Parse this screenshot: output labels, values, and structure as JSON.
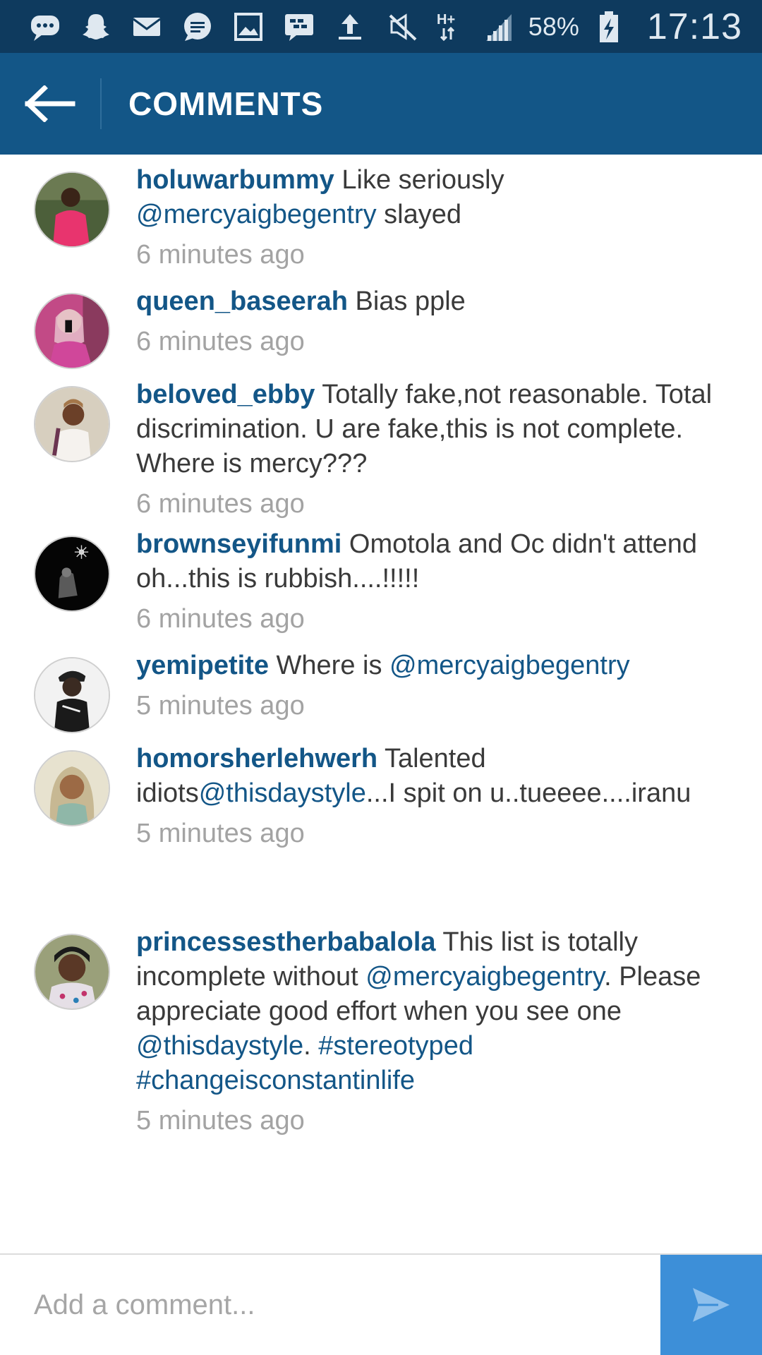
{
  "status_bar": {
    "battery_percent": "58%",
    "clock": "17:13",
    "network_label": "H+",
    "icons": [
      "messenger-icon",
      "snapchat-icon",
      "mail-icon",
      "chat-bubble-icon",
      "gallery-icon",
      "bbm-icon",
      "upload-icon",
      "mute-icon",
      "network-data-icon",
      "signal-icon",
      "battery-charging-icon"
    ]
  },
  "header": {
    "title": "COMMENTS",
    "back_icon": "back-arrow-icon"
  },
  "comments": [
    {
      "username": "holuwarbummy",
      "parts": [
        {
          "type": "text",
          "value": " Like seriously "
        },
        {
          "type": "mention",
          "value": "@mercyaigbegentry"
        },
        {
          "type": "text",
          "value": "  slayed"
        }
      ],
      "time": "6 minutes ago"
    },
    {
      "username": "queen_baseerah",
      "parts": [
        {
          "type": "text",
          "value": " Bias pple"
        }
      ],
      "time": "6 minutes ago"
    },
    {
      "username": "beloved_ebby",
      "parts": [
        {
          "type": "text",
          "value": " Totally fake,not reasonable. Total discrimination. U are fake,this is not complete. Where is mercy???"
        }
      ],
      "time": "6 minutes ago"
    },
    {
      "username": "brownseyifunmi",
      "parts": [
        {
          "type": "text",
          "value": " Omotola and Oc didn't attend oh...this is rubbish....!!!!!"
        }
      ],
      "time": "6 minutes ago"
    },
    {
      "username": "yemipetite",
      "parts": [
        {
          "type": "text",
          "value": " Where is "
        },
        {
          "type": "mention",
          "value": "@mercyaigbegentry"
        }
      ],
      "time": "5 minutes ago"
    },
    {
      "username": "homorsherlehwerh",
      "parts": [
        {
          "type": "text",
          "value": " Talented idiots"
        },
        {
          "type": "mention",
          "value": "@thisdaystyle"
        },
        {
          "type": "text",
          "value": "...I spit on u..tueeee....iranu"
        }
      ],
      "time": "5 minutes ago"
    },
    {
      "username": "princessestherbabalola",
      "parts": [
        {
          "type": "text",
          "value": " This list is totally incomplete without "
        },
        {
          "type": "mention",
          "value": "@mercyaigbegentry"
        },
        {
          "type": "text",
          "value": ". Please appreciate good effort when you see one "
        },
        {
          "type": "mention",
          "value": "@thisdaystyle"
        },
        {
          "type": "text",
          "value": ". "
        },
        {
          "type": "mention",
          "value": "#stereotyped"
        },
        {
          "type": "text",
          "value": " "
        },
        {
          "type": "mention",
          "value": "#changeisconstantinlife"
        }
      ],
      "time": "5 minutes ago"
    }
  ],
  "composer": {
    "placeholder": "Add a comment...",
    "value": "",
    "send_icon": "send-icon"
  },
  "colors": {
    "status_bar": "#0e3a5e",
    "action_bar": "#135687",
    "username": "#135687",
    "timestamp": "#a3a3a3",
    "send_button": "#3d8fd8"
  }
}
